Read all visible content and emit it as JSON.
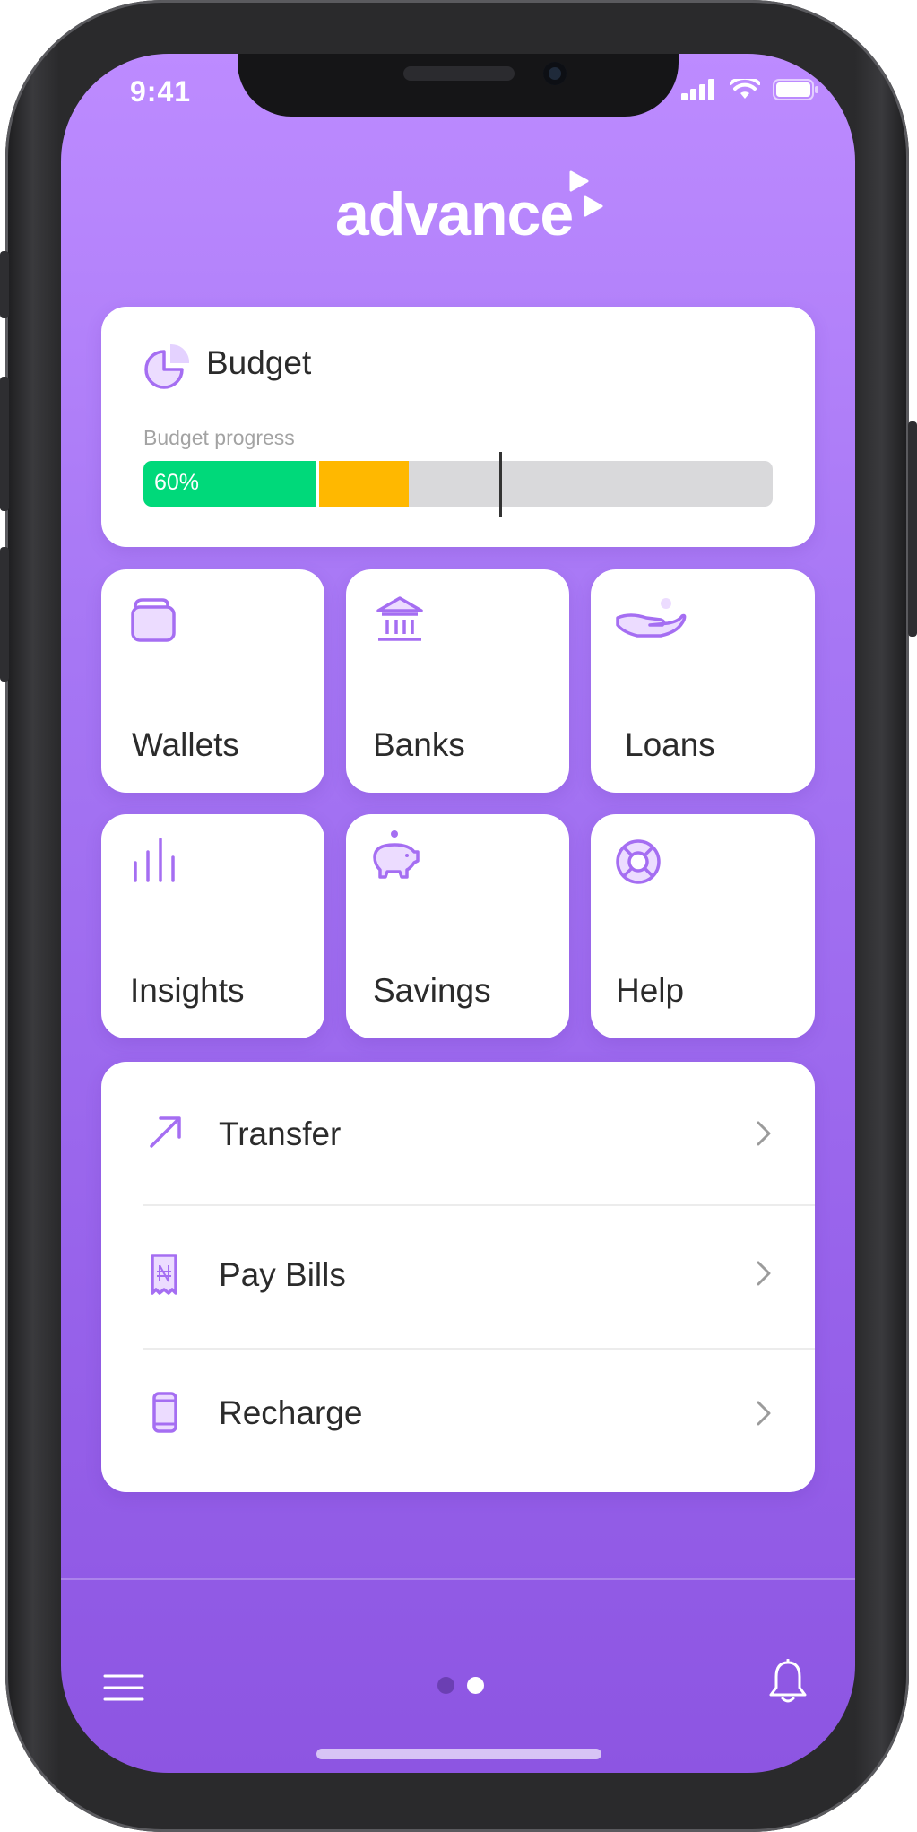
{
  "status_bar": {
    "time": "9:41"
  },
  "app": {
    "logo_text": "advance"
  },
  "budget": {
    "title": "Budget",
    "subtitle": "Budget progress",
    "progress_label": "60%",
    "progress_fraction": 0.6,
    "colors": {
      "spent": "#00d97a",
      "pending": "#ffb800",
      "remaining": "#d9d9db"
    }
  },
  "tiles": [
    {
      "label": "Wallets",
      "icon": "wallet-icon"
    },
    {
      "label": "Banks",
      "icon": "bank-icon"
    },
    {
      "label": "Loans",
      "icon": "loan-hand-icon"
    },
    {
      "label": "Insights",
      "icon": "bar-chart-icon"
    },
    {
      "label": "Savings",
      "icon": "piggy-bank-icon"
    },
    {
      "label": "Help",
      "icon": "lifebuoy-icon"
    }
  ],
  "actions": [
    {
      "label": "Transfer",
      "icon": "arrow-up-right-icon"
    },
    {
      "label": "Pay Bills",
      "icon": "receipt-icon"
    },
    {
      "label": "Recharge",
      "icon": "phone-icon"
    }
  ],
  "bottom_nav": {
    "menu_icon": "hamburger-icon",
    "notification_icon": "bell-icon",
    "page_count": 2,
    "active_page": 2
  },
  "theme": {
    "accent": "#a56ef2",
    "gradient_top": "#bd8bff",
    "gradient_bottom": "#8d55e2"
  }
}
